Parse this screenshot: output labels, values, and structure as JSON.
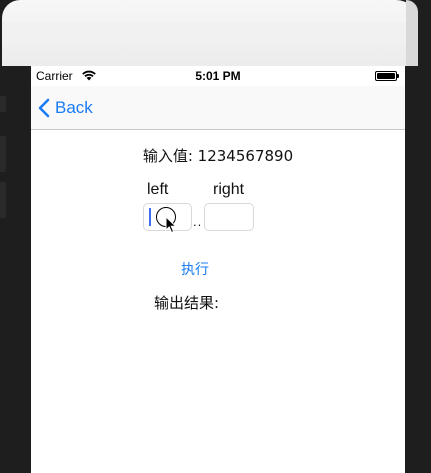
{
  "status_bar": {
    "carrier": "Carrier",
    "time": "5:01 PM",
    "battery_level": 1.0
  },
  "nav": {
    "back_label": "Back"
  },
  "content": {
    "input_value_text": "输入值: 1234567890",
    "left_label": "left",
    "right_label": "right",
    "left_value": "",
    "right_value": "",
    "separator": "..",
    "run_label": "执行",
    "output_label": "输出结果:"
  },
  "colors": {
    "accent": "#1a7cf5",
    "caret": "#3a6df0",
    "screen_bg": "#ffffff",
    "bezel": "#1e1e1e"
  },
  "icons": {
    "back": "chevron-left-icon",
    "wifi": "wifi-icon",
    "battery": "battery-icon",
    "pointer": "mouse-pointer-icon"
  }
}
